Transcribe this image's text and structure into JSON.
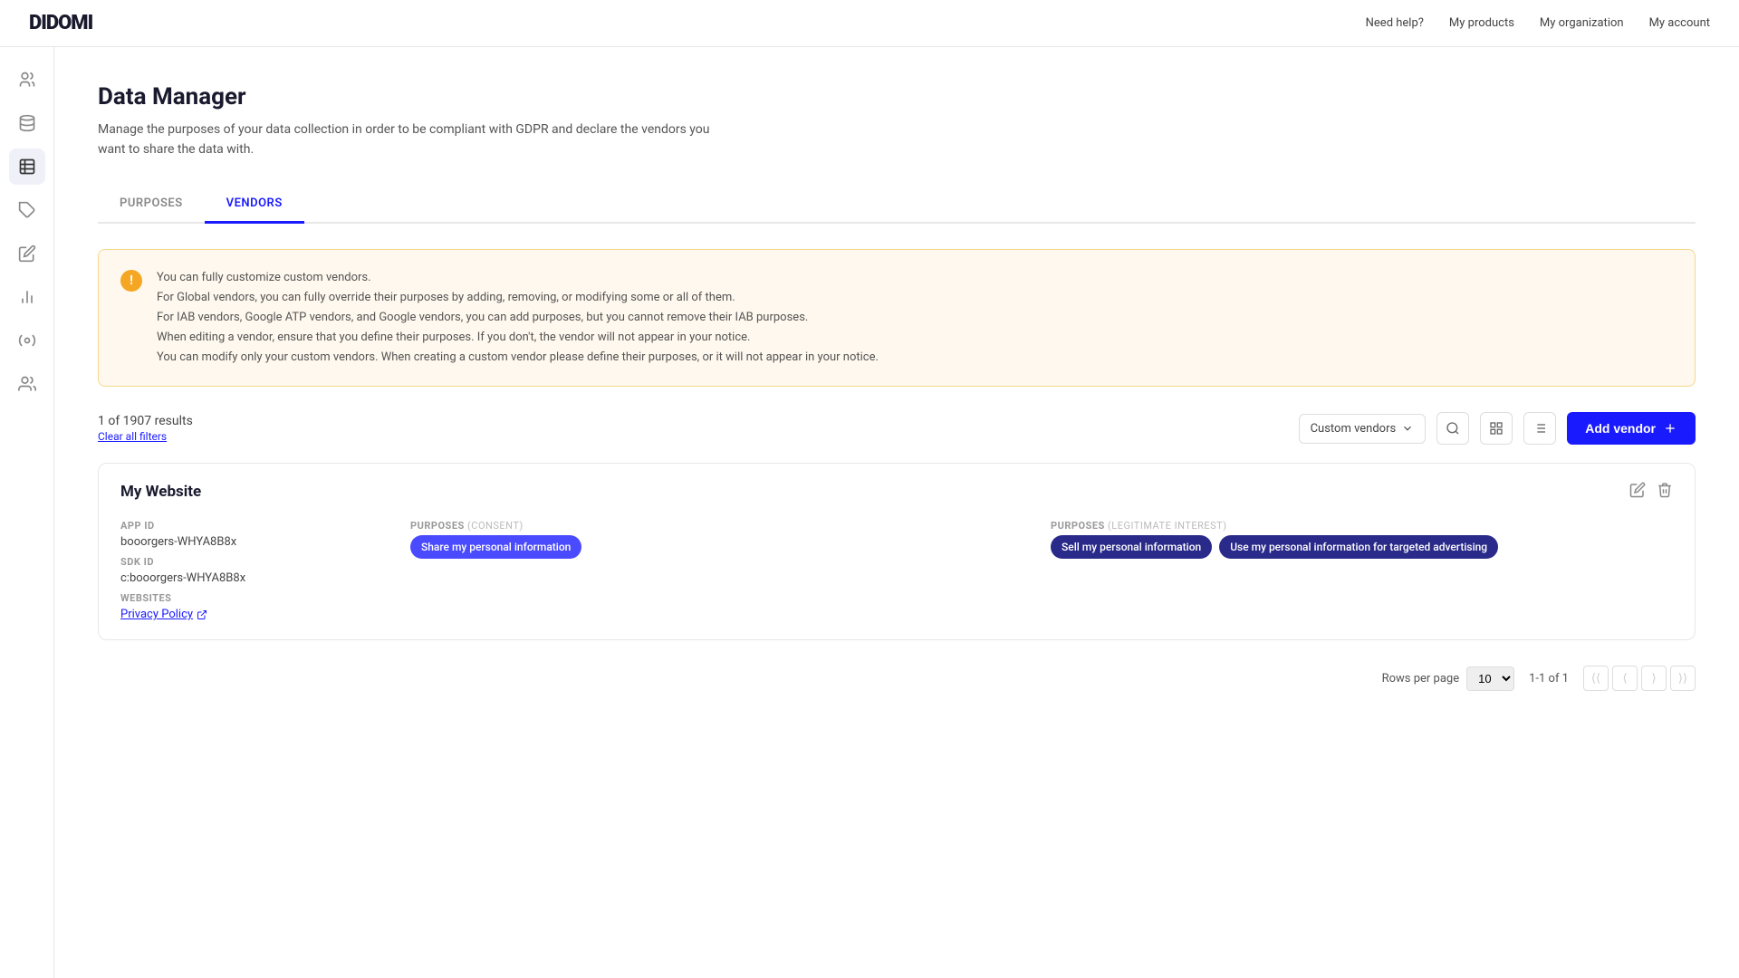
{
  "topnav": {
    "logo": "DIDOMI",
    "links": [
      "Need help?",
      "My products",
      "My organization",
      "My account"
    ]
  },
  "sidebar": {
    "icons": [
      {
        "name": "users-icon",
        "symbol": "👤"
      },
      {
        "name": "database-icon",
        "symbol": "🗄"
      },
      {
        "name": "list-icon",
        "symbol": "📋"
      },
      {
        "name": "tag-icon",
        "symbol": "🏷"
      },
      {
        "name": "edit-icon",
        "symbol": "✏️"
      },
      {
        "name": "chart-icon",
        "symbol": "📊"
      },
      {
        "name": "settings-icon",
        "symbol": "⚙"
      },
      {
        "name": "team-icon",
        "symbol": "👥"
      }
    ]
  },
  "page": {
    "title": "Data Manager",
    "subtitle": "Manage the purposes of your data collection in order to be compliant with GDPR and declare the vendors\nyou want to share the data with."
  },
  "tabs": [
    {
      "label": "PURPOSES",
      "active": false
    },
    {
      "label": "VENDORS",
      "active": true
    }
  ],
  "infobox": {
    "lines": [
      "You can fully customize custom vendors.",
      "For Global vendors, you can fully override their purposes by adding, removing, or modifying some or all of them.",
      "For IAB vendors, Google ATP vendors, and Google vendors, you can add purposes, but you cannot remove their IAB purposes.",
      "When editing a vendor, ensure that you define their purposes. If you don't, the vendor will not appear in your notice.",
      "You can modify only your custom vendors. When creating a custom vendor please define their purposes, or it will not appear in your notice."
    ]
  },
  "toolbar": {
    "results_count": "1 of 1907 results",
    "clear_filters": "Clear all filters",
    "filter_label": "Custom vendors",
    "add_vendor_label": "Add vendor"
  },
  "vendors": [
    {
      "name": "My Website",
      "app_id_label": "APP ID",
      "app_id_value": "booorgers-WHYA8B8x",
      "sdk_id_label": "SDK ID",
      "sdk_id_value": "c:booorgers-WHYA8B8x",
      "websites_label": "WEBSITES",
      "privacy_policy_label": "Privacy Policy",
      "purposes_consent_label": "PURPOSES",
      "purposes_consent_sub": "(CONSENT)",
      "purposes_legit_label": "PURPOSES",
      "purposes_legit_sub": "(LEGITIMATE INTEREST)",
      "consent_tags": [
        "Share my personal information"
      ],
      "legit_tags": [
        "Sell my personal information",
        "Use my personal information for targeted advertising"
      ]
    }
  ],
  "pagination": {
    "rows_per_page_label": "Rows per page",
    "rows_value": "10",
    "page_info": "1-1 of 1"
  }
}
